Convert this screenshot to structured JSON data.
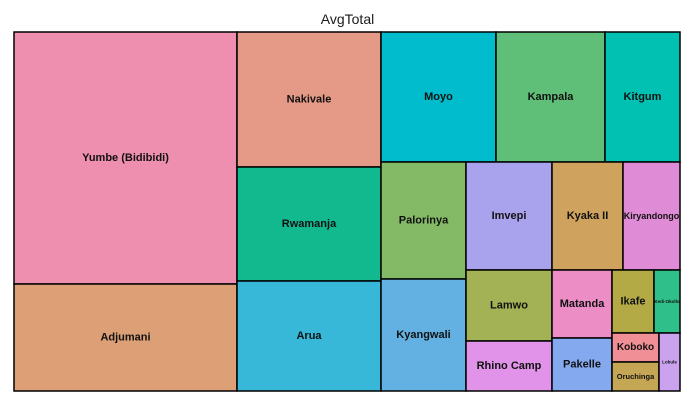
{
  "chart_data": {
    "type": "treemap",
    "title": "AvgTotal",
    "tiles": [
      {
        "label": "Yumbe (Bidibidi)",
        "color": "#ee8fb0"
      },
      {
        "label": "Adjumani",
        "color": "#dc9f76"
      },
      {
        "label": "Nakivale",
        "color": "#e59a88"
      },
      {
        "label": "Rwamanja",
        "color": "#12b98f"
      },
      {
        "label": "Arua",
        "color": "#37b8d9"
      },
      {
        "label": "Moyo",
        "color": "#00bccc"
      },
      {
        "label": "Kampala",
        "color": "#5fbe78"
      },
      {
        "label": "Kitgum",
        "color": "#00c1b2"
      },
      {
        "label": "Palorinya",
        "color": "#84b966"
      },
      {
        "label": "Kyangwali",
        "color": "#63b1e3"
      },
      {
        "label": "Imvepi",
        "color": "#a9a3ee"
      },
      {
        "label": "Kyaka II",
        "color": "#cfa35e"
      },
      {
        "label": "Kiryandongo",
        "color": "#e08bd5"
      },
      {
        "label": "Lamwo",
        "color": "#a2b254"
      },
      {
        "label": "Rhino Camp",
        "color": "#e093e9"
      },
      {
        "label": "Matanda",
        "color": "#ec8dc6"
      },
      {
        "label": "Pakelle",
        "color": "#84a9ef"
      },
      {
        "label": "Ikafe",
        "color": "#b3aa46"
      },
      {
        "label": "Kedi-Okollo",
        "color": "#2ebf8a"
      },
      {
        "label": "Koboko",
        "color": "#f08f96"
      },
      {
        "label": "Oruchinga",
        "color": "#c5a654"
      },
      {
        "label": "Lobule",
        "color": "#caa2ee"
      }
    ]
  }
}
